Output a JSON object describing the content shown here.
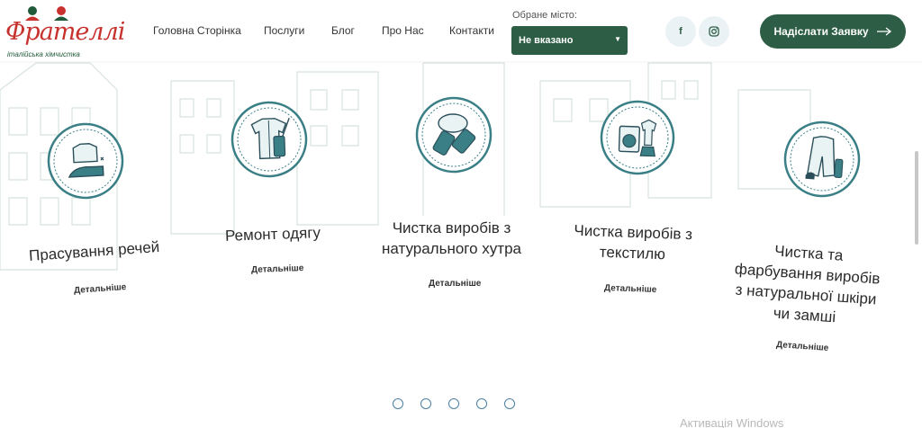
{
  "logo": {
    "name": "Фрателлі",
    "tagline": "італійська хімчистка",
    "colors": {
      "red": "#c7322e",
      "green": "#1f5a3a"
    }
  },
  "nav": {
    "items": [
      {
        "label": "Головна Сторінка"
      },
      {
        "label": "Послуги"
      },
      {
        "label": "Блог"
      },
      {
        "label": "Про Нас"
      },
      {
        "label": "Контакти"
      }
    ]
  },
  "city": {
    "label": "Обране місто:",
    "selected": "Не вказано"
  },
  "social": {
    "facebook": "f",
    "instagram": "instagram-icon"
  },
  "cta": {
    "label": "Надіслати Заявку"
  },
  "services": [
    {
      "title": "Прасування речей",
      "link": "Детальніше",
      "icon": "ironing-icon"
    },
    {
      "title": "Ремонт одягу",
      "link": "Детальніше",
      "icon": "sewing-shirt-icon"
    },
    {
      "title_lines": [
        "Чистка виробів з",
        "натурального хутра"
      ],
      "link": "Детальніше",
      "icon": "fur-brush-icon"
    },
    {
      "title_lines": [
        "Чистка виробів з",
        "текстилю"
      ],
      "link": "Детальніше",
      "icon": "washing-machine-icon"
    },
    {
      "title_lines": [
        "Чистка та",
        "фарбування виробів",
        "з натуральної шкіри",
        "чи замші"
      ],
      "link": "Детальніше",
      "icon": "leather-coat-icon"
    }
  ],
  "pager": {
    "count": 5
  },
  "watermark": "Активація Windows",
  "colors": {
    "accent": "#2d5e45",
    "icon_ring": "#3a7f86",
    "dot": "#4a7fa0"
  }
}
